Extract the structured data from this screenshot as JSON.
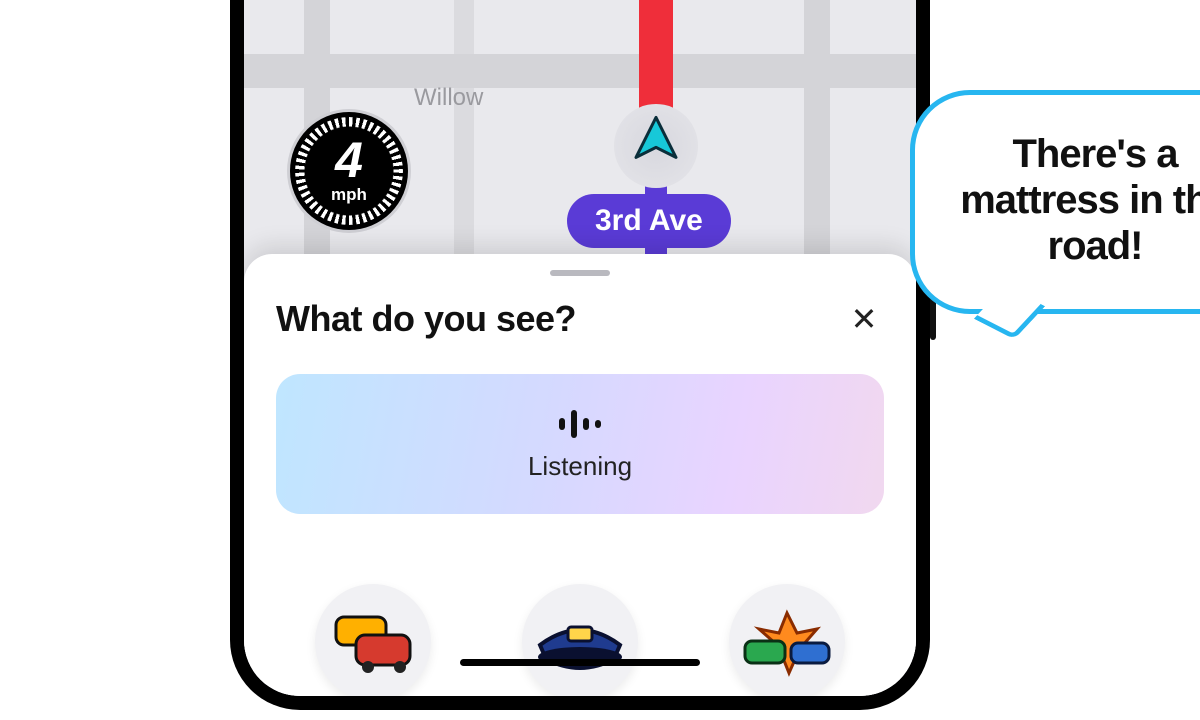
{
  "map": {
    "street_label_top": "Willow",
    "current_street": "3rd Ave"
  },
  "speed": {
    "value": "4",
    "unit": "mph"
  },
  "sheet": {
    "title": "What do you see?",
    "close_glyph": "✕",
    "listen_label": "Listening"
  },
  "reports": {
    "traffic_name": "traffic",
    "police_name": "police",
    "crash_name": "crash"
  },
  "speech": {
    "text": "There's a mattress in the road!"
  }
}
